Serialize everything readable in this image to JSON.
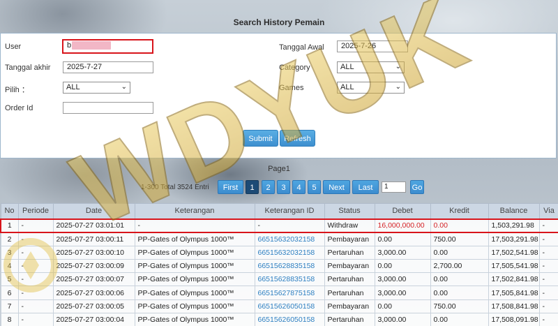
{
  "page_title": "Search History Pemain",
  "form": {
    "user_label": "User",
    "user_value": "b",
    "tanggal_akhir_label": "Tanggal akhir",
    "tanggal_akhir_value": "2025-7-27",
    "pilih_label": "Pilih ：",
    "pilih_value": "ALL",
    "order_id_label": "Order Id",
    "order_id_value": "",
    "tanggal_awal_label": "Tanggal Awal",
    "tanggal_awal_value": "2025-7-26",
    "category_label": "Category",
    "category_value": "ALL",
    "games_label": "Games",
    "games_value": "ALL",
    "submit_label": "Submit",
    "refresh_label": "Refresh"
  },
  "pager": {
    "title": "Page1",
    "info": "1-300 Total 3524 Entri",
    "first": "First",
    "pages": [
      "1",
      "2",
      "3",
      "4",
      "5"
    ],
    "next": "Next",
    "last": "Last",
    "page_input": "1",
    "go": "Go"
  },
  "table": {
    "headers": [
      "No",
      "Periode",
      "Date",
      "Keterangan",
      "Keterangan ID",
      "Status",
      "Debet",
      "Kredit",
      "Balance",
      "Via"
    ],
    "rows": [
      [
        "1",
        "-",
        "2025-07-27 03:01:01",
        "-",
        "-",
        "Withdraw",
        "16,000,000.00",
        "0.00",
        "1,503,291.98",
        "-"
      ],
      [
        "2",
        "-",
        "2025-07-27 03:00:11",
        "PP-Gates of Olympus 1000™",
        "66515632032158",
        "Pembayaran",
        "0.00",
        "750.00",
        "17,503,291.98",
        "-"
      ],
      [
        "3",
        "-",
        "2025-07-27 03:00:10",
        "PP-Gates of Olympus 1000™",
        "66515632032158",
        "Pertaruhan",
        "3,000.00",
        "0.00",
        "17,502,541.98",
        "-"
      ],
      [
        "4",
        "-",
        "2025-07-27 03:00:09",
        "PP-Gates of Olympus 1000™",
        "66515628835158",
        "Pembayaran",
        "0.00",
        "2,700.00",
        "17,505,541.98",
        "-"
      ],
      [
        "5",
        "-",
        "2025-07-27 03:00:07",
        "PP-Gates of Olympus 1000™",
        "66515628835158",
        "Pertaruhan",
        "3,000.00",
        "0.00",
        "17,502,841.98",
        "-"
      ],
      [
        "6",
        "-",
        "2025-07-27 03:00:06",
        "PP-Gates of Olympus 1000™",
        "66515627875158",
        "Pertaruhan",
        "3,000.00",
        "0.00",
        "17,505,841.98",
        "-"
      ],
      [
        "7",
        "-",
        "2025-07-27 03:00:05",
        "PP-Gates of Olympus 1000™",
        "66515626050158",
        "Pembayaran",
        "0.00",
        "750.00",
        "17,508,841.98",
        "-"
      ],
      [
        "8",
        "-",
        "2025-07-27 03:00:04",
        "PP-Gates of Olympus 1000™",
        "66515626050158",
        "Pertaruhan",
        "3,000.00",
        "0.00",
        "17,508,091.98",
        "-"
      ]
    ]
  },
  "watermark": "WDYUK",
  "colors": {
    "accent_blue": "#3d8fcf",
    "highlight_red": "#d8141b",
    "link_blue": "#2d7fc1",
    "header_bg": "#ccd7e4",
    "watermark_gold": "#e3c24a"
  }
}
